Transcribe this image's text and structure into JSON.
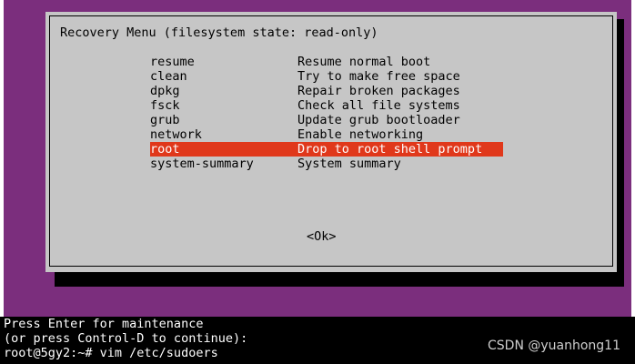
{
  "dialog": {
    "title": "Recovery Menu (filesystem state: read-only)",
    "items": [
      {
        "key": "resume",
        "description": "Resume normal boot",
        "selected": false
      },
      {
        "key": "clean",
        "description": "Try to make free space",
        "selected": false
      },
      {
        "key": "dpkg",
        "description": "Repair broken packages",
        "selected": false
      },
      {
        "key": "fsck",
        "description": "Check all file systems",
        "selected": false
      },
      {
        "key": "grub",
        "description": "Update grub bootloader",
        "selected": false
      },
      {
        "key": "network",
        "description": "Enable networking",
        "selected": false
      },
      {
        "key": "root",
        "description": "Drop to root shell prompt",
        "selected": true
      },
      {
        "key": "system-summary",
        "description": "System summary",
        "selected": false
      }
    ],
    "ok_label": "<Ok>"
  },
  "terminal": {
    "lines": [
      "Press Enter for maintenance",
      "(or press Control-D to continue):",
      "root@5gy2:~# vim /etc/sudoers"
    ]
  },
  "watermark": "CSDN @yuanhong11",
  "colors": {
    "background": "#7b2e7d",
    "dialog": "#c6c6c6",
    "highlight": "#e0381b",
    "terminal": "#000000"
  }
}
